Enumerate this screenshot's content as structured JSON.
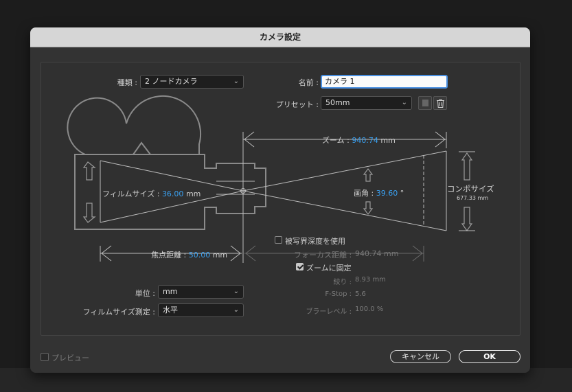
{
  "dialog": {
    "title": "カメラ設定"
  },
  "type_field": {
    "label": "種類 :",
    "value": "2 ノードカメラ"
  },
  "name_field": {
    "label": "名前 :",
    "value": "カメラ 1"
  },
  "preset_field": {
    "label": "プリセット :",
    "value": "50mm"
  },
  "diagram": {
    "zoom": {
      "label": "ズーム :",
      "value": "940.74",
      "unit": "mm"
    },
    "film_size": {
      "label": "フィルムサイズ :",
      "value": "36.00",
      "unit": "mm"
    },
    "angle": {
      "label": "画角 :",
      "value": "39.60",
      "unit": "°"
    },
    "comp_size": {
      "label": "コンポサイズ",
      "value": "677.33 mm"
    },
    "focal_length": {
      "label": "焦点距離 :",
      "value": "50.00",
      "unit": "mm"
    },
    "focus_distance": {
      "label": "フォーカス距離 :",
      "value": "940.74 mm"
    }
  },
  "depth_of_field": {
    "label": "被写界深度を使用",
    "checked": false
  },
  "lock_to_zoom": {
    "label": "ズームに固定",
    "checked": true
  },
  "aperture": {
    "label": "絞り :",
    "value": "8.93 mm"
  },
  "fstop": {
    "label": "F-Stop :",
    "value": "5.6"
  },
  "blur_level": {
    "label": "ブラーレベル :",
    "value": "100.0 %"
  },
  "units_field": {
    "label": "単位 :",
    "value": "mm"
  },
  "film_measure_field": {
    "label": "フィルムサイズ測定 :",
    "value": "水平"
  },
  "preview": {
    "label": "プレビュー",
    "checked": false
  },
  "buttons": {
    "cancel": "キャンセル",
    "ok": "OK"
  },
  "colors": {
    "accent_value": "#3aa0f0",
    "focus_ring": "#4a90e2"
  },
  "icons": {
    "save_preset": "save-preset-icon",
    "delete_preset": "trash-icon"
  }
}
